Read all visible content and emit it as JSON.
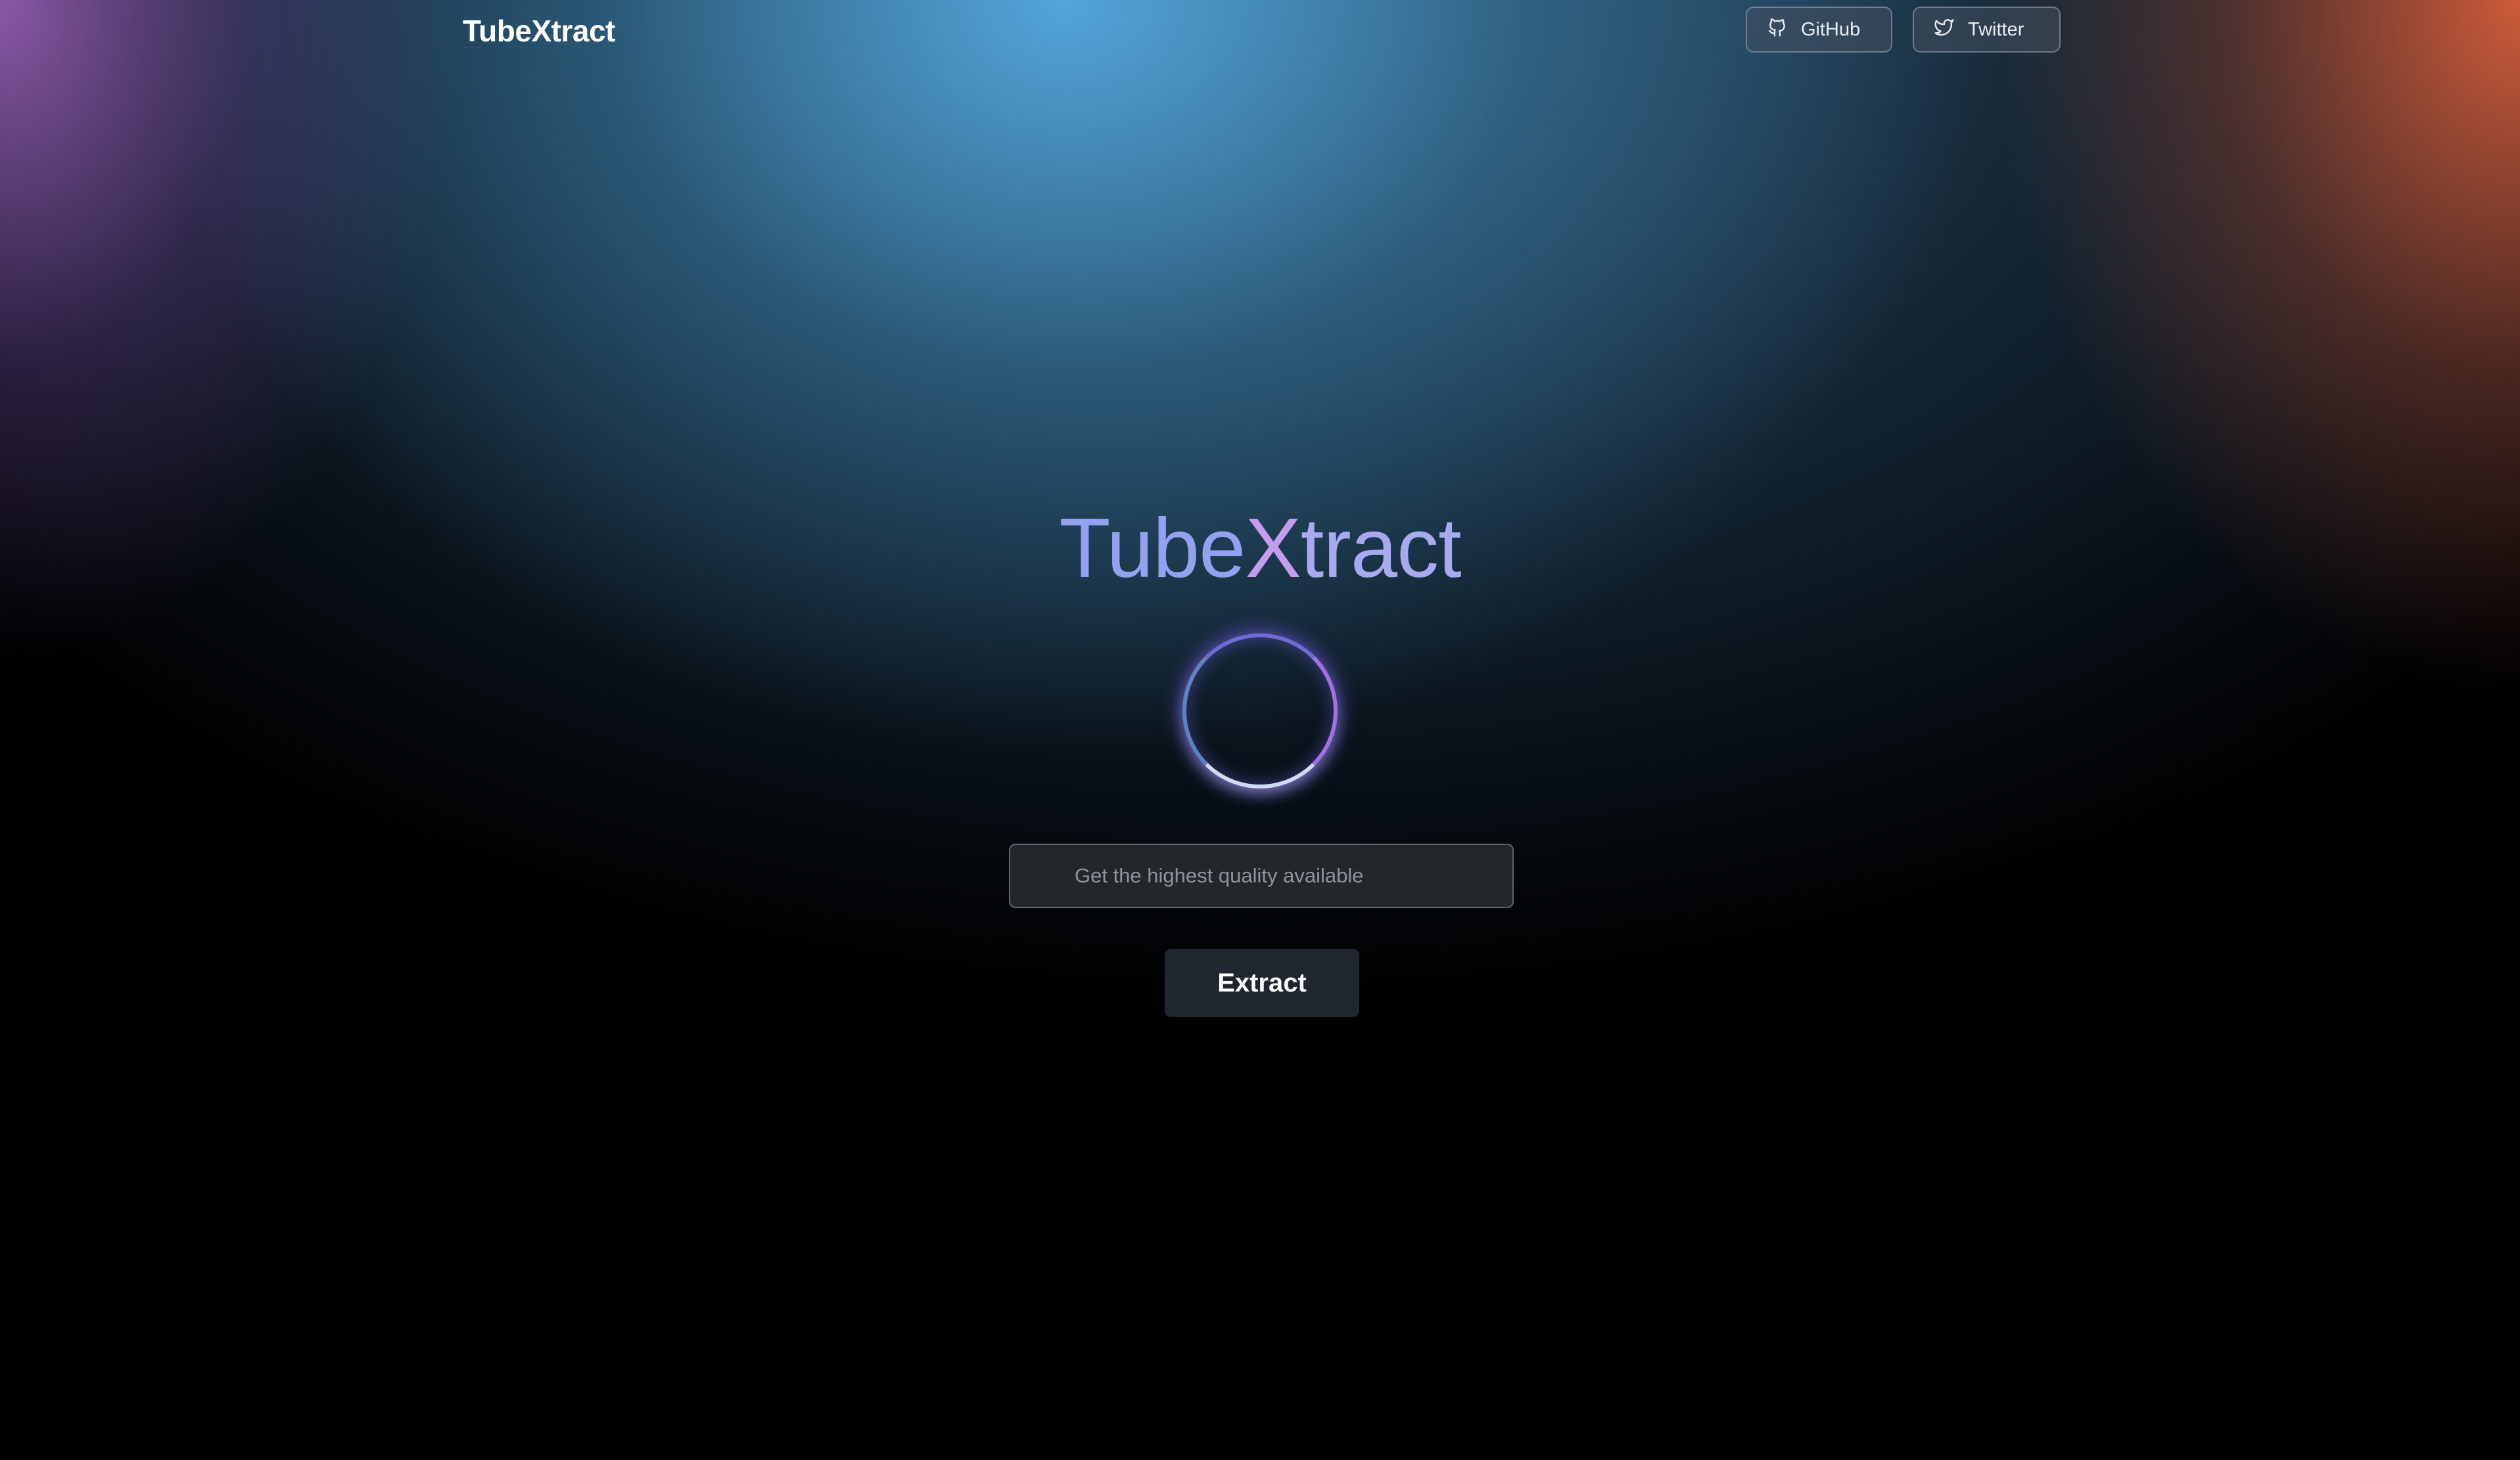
{
  "header": {
    "brand": "TubeXtract",
    "nav": [
      {
        "label": "GitHub",
        "icon": "github-icon"
      },
      {
        "label": "Twitter",
        "icon": "twitter-icon"
      }
    ]
  },
  "hero": {
    "title_parts": [
      "Tube",
      "X",
      "tract"
    ],
    "input_placeholder": "Get the highest quality available",
    "input_value": "",
    "button_label": "Extract"
  },
  "colors": {
    "background": "#000000",
    "title_gradient_start": "#93a1f0",
    "title_gradient_accent": "#c59cf0",
    "orb_glow": "#7d73e6",
    "button_bg": "#1f2630"
  }
}
